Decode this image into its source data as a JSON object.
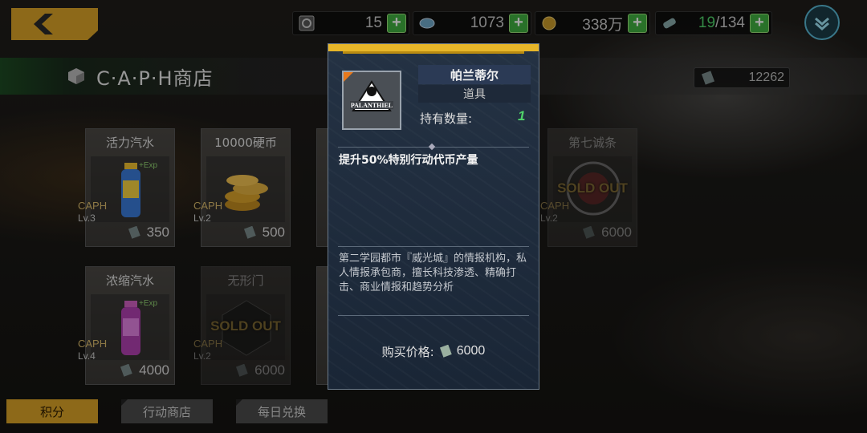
{
  "resources": [
    {
      "icon": "ticket-icon",
      "value": "15"
    },
    {
      "icon": "gem-icon",
      "value": "1073"
    },
    {
      "icon": "coin-icon",
      "value": "338万"
    },
    {
      "icon": "stamina-icon",
      "value_current": "19",
      "value_max": "/134"
    }
  ],
  "shop": {
    "title": "C·A·P·H商店",
    "points": "12262"
  },
  "items": [
    {
      "name": "活力汽水",
      "caph": "CAPH",
      "lv": "Lv.3",
      "price": "350"
    },
    {
      "name": "10000硬币",
      "caph": "CAPH",
      "lv": "Lv.2",
      "price": "500"
    },
    {
      "name": "第七诚条",
      "caph": "CAPH",
      "lv": "Lv.2",
      "price": "6000",
      "sold_out": "SOLD OUT"
    },
    {
      "name": "浓缩汽水",
      "caph": "CAPH",
      "lv": "Lv.4",
      "price": "4000"
    },
    {
      "name": "无形门",
      "caph": "CAPH",
      "lv": "Lv.2",
      "price": "6000",
      "sold_out": "SOLD OUT"
    }
  ],
  "tabs": [
    "积分",
    "行动商店",
    "每日兑换"
  ],
  "detail": {
    "name": "帕兰蒂尔",
    "type": "道具",
    "logo_text": "PALANTHIEL",
    "own_label": "持有数量:",
    "own_value": "1",
    "effect": "提升50%特别行动代币产量",
    "description": "第二学园都市『威光城』的情报机构，私人情报承包商，擅长科技渗透、精确打击、商业情报和趋势分析",
    "price_label": "购买价格:",
    "price": "6000"
  },
  "colors": {
    "accent": "#d9a227",
    "plus": "#3fae3f",
    "highlight": "#4fd36a",
    "popup_bg": "#1f2c3e"
  }
}
